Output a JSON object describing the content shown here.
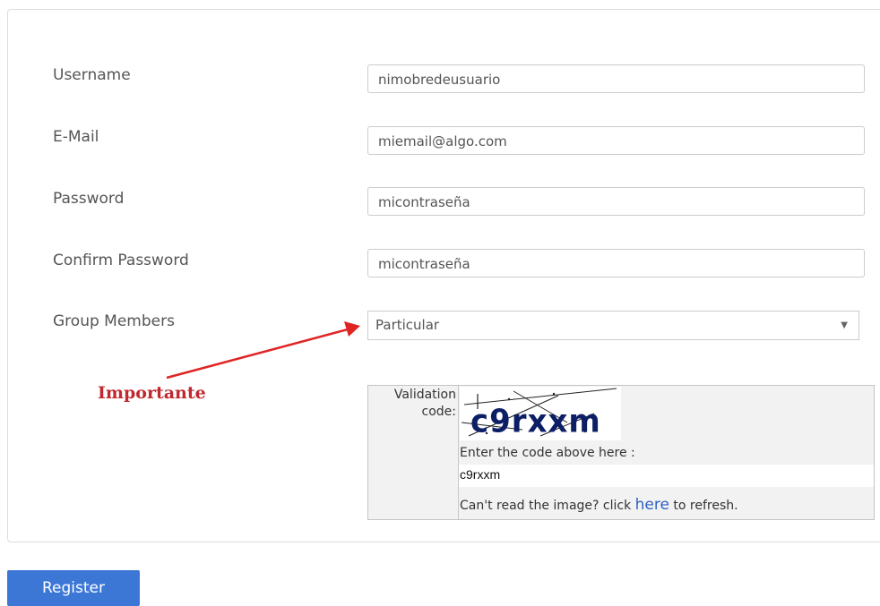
{
  "form": {
    "username": {
      "label": "Username",
      "value": "nimobredeusuario"
    },
    "email": {
      "label": "E-Mail",
      "value": "miemail@algo.com"
    },
    "password": {
      "label": "Password",
      "value": "micontraseña"
    },
    "confirm_password": {
      "label": "Confirm Password",
      "value": "micontraseña"
    },
    "group": {
      "label": "Group Members",
      "selected": "Particular"
    }
  },
  "annotation": {
    "text": "Importante",
    "color": "#c0292f"
  },
  "captcha": {
    "label_line1": "Validation",
    "label_line2": "code:",
    "image_text": "c9rxxm",
    "instruction": "Enter the code above here :",
    "input_value": "c9rxxm",
    "refresh_prefix": "Can't read the image? click ",
    "refresh_link": "here",
    "refresh_suffix": " to refresh."
  },
  "register_button": {
    "label": "Register",
    "color": "#3d77d6"
  }
}
